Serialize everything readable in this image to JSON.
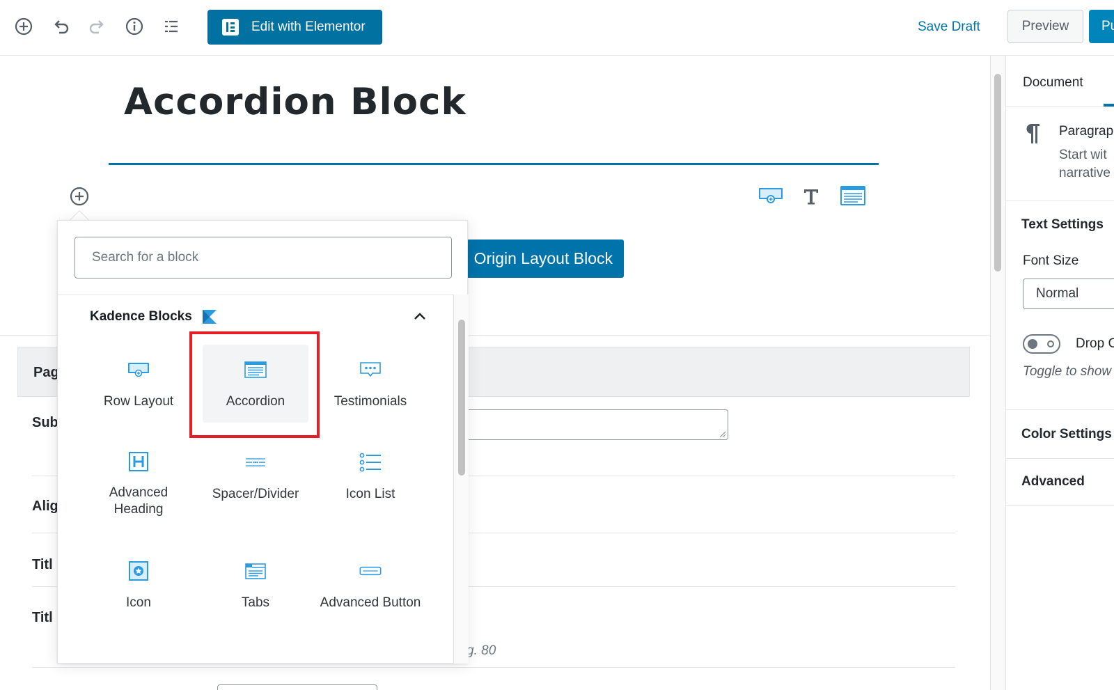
{
  "toolbar": {
    "elementor_label": "Edit with Elementor",
    "save_draft": "Save Draft",
    "preview": "Preview",
    "publish": "Pu"
  },
  "editor": {
    "post_title": "Accordion Block",
    "origin_button": "Origin Layout Block"
  },
  "metabox": {
    "header": "Pag",
    "labels": [
      "Sub",
      "Alig",
      "Titl",
      "Titl"
    ],
    "hint": "g. 80"
  },
  "sidebar": {
    "tab": "Document",
    "block_name": "Paragrap",
    "block_desc_1": "Start wit",
    "block_desc_2": "narrative",
    "text_settings": "Text Settings",
    "font_size_label": "Font Size",
    "font_size_value": "Normal",
    "drop_cap": "Drop C",
    "toggle_hint": "Toggle to show",
    "color_settings": "Color Settings",
    "advanced": "Advanced"
  },
  "inserter": {
    "search_placeholder": "Search for a block",
    "panel_title": "Kadence Blocks",
    "blocks": [
      {
        "label": "Row Layout",
        "icon": "row-layout-icon"
      },
      {
        "label": "Accordion",
        "icon": "accordion-icon"
      },
      {
        "label": "Testimonials",
        "icon": "testimonials-icon"
      },
      {
        "label": "Advanced Heading",
        "icon": "advanced-heading-icon"
      },
      {
        "label": "Spacer/Divider",
        "icon": "spacer-divider-icon"
      },
      {
        "label": "Icon List",
        "icon": "icon-list-icon"
      },
      {
        "label": "Icon",
        "icon": "icon-block-icon"
      },
      {
        "label": "Tabs",
        "icon": "tabs-icon"
      },
      {
        "label": "Advanced Button",
        "icon": "advanced-button-icon"
      }
    ]
  },
  "colors": {
    "accent": "#0073aa",
    "kadence_blue": "#2b9be0",
    "highlight": "#e51e25"
  }
}
